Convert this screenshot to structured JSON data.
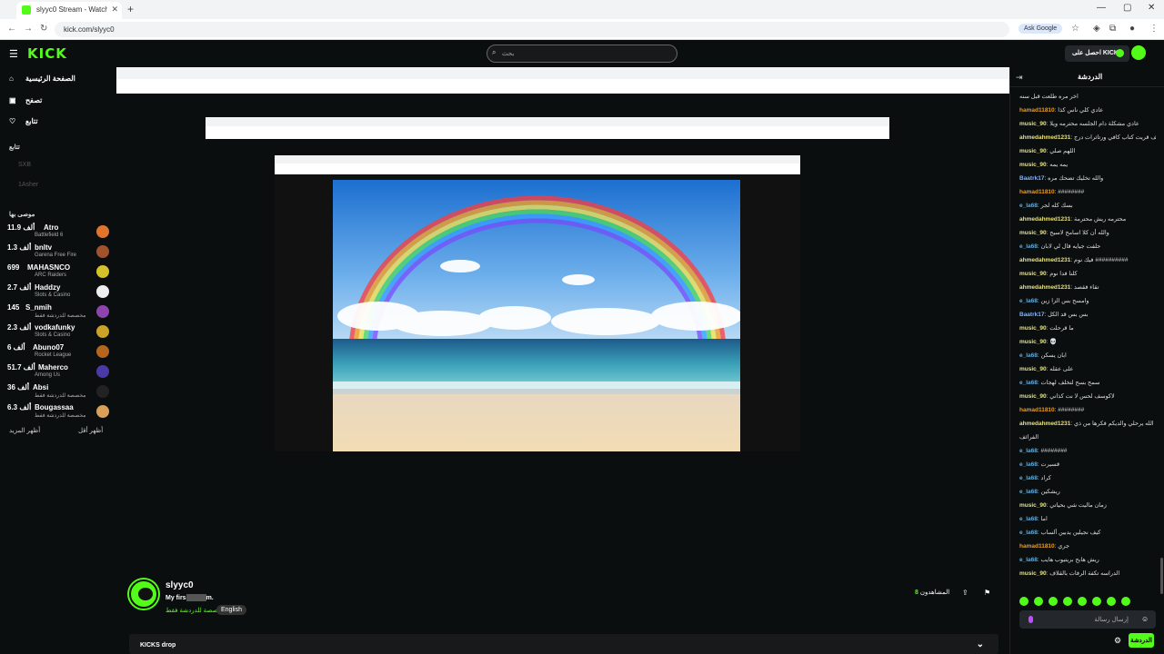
{
  "browser": {
    "tab_title": "slyyc0 Stream - Watch Live on Kick",
    "url": "kick.com/slyyc0",
    "ask_google": "Ask Google"
  },
  "header": {
    "logo": "KICK",
    "search_placeholder": "بحث",
    "get_kicks": "احصل على KICKs"
  },
  "sidebar": {
    "nav": [
      {
        "label": "الصفحة الرئيسية",
        "icon": "home-icon"
      },
      {
        "label": "تصفح",
        "icon": "browse-icon"
      },
      {
        "label": "تتابع",
        "icon": "heart-icon"
      }
    ],
    "following_title": "تتابع",
    "followed": [
      "SXB",
      "1Asher"
    ],
    "recommended_title": "موصى بها",
    "channels": [
      {
        "viewers": "11.9 ألف",
        "name": "Atro",
        "category": "Battlefield 6",
        "color": "#e0742c"
      },
      {
        "viewers": "1.3 ألف",
        "name": "bnltv",
        "category": "Garena Free Fire",
        "color": "#a0522d"
      },
      {
        "viewers": "699",
        "name": "MAHASNCO",
        "category": "ARC Raiders",
        "color": "#d4c22a"
      },
      {
        "viewers": "2.7 ألف",
        "name": "Haddzy",
        "category": "Slots & Casino",
        "color": "#eeeeee"
      },
      {
        "viewers": "145",
        "name": "S_nmih",
        "category": "مخصصة للدردشة فقط",
        "color": "#8e44ad"
      },
      {
        "viewers": "2.3 ألف",
        "name": "vodkafunky",
        "category": "Slots & Casino",
        "color": "#c9a227"
      },
      {
        "viewers": "6 ألف",
        "name": "Abuno07",
        "category": "Rocket League",
        "color": "#b5651d"
      },
      {
        "viewers": "51.7 ألف",
        "name": "Maherco",
        "category": "Among Us",
        "color": "#4a3aa8"
      },
      {
        "viewers": "36 ألف",
        "name": "Absi",
        "category": "مخصصة للدردشة فقط",
        "color": "#222222"
      },
      {
        "viewers": "6.3 ألف",
        "name": "Bougassaa",
        "category": "مخصصة للدردشة فقط",
        "color": "#d9a05b"
      }
    ],
    "show_more": "أظهر المزيد",
    "show_less": "أظهر أقل"
  },
  "stream": {
    "channel_name": "slyyc0",
    "title_prefix": "My firs",
    "title_suffix": "m.",
    "category": "مخصصة للدردشة فقط",
    "language": "English",
    "viewers_label": "المشاهدون",
    "viewers_count": "8",
    "kicks_drop": "KICKS drop"
  },
  "chat": {
    "title": "الدردشة",
    "input_placeholder": "إرسال رسالة",
    "send_label": "الدردشة",
    "messages": [
      {
        "user": "",
        "color": "#ddd",
        "text": "اخر مره طلعت قبل سنه"
      },
      {
        "user": "hamad11810",
        "color": "#f39c12",
        "text": ": عادي كلي ناس كذا"
      },
      {
        "user": "music_90",
        "color": "#e8e27a",
        "text": ": عادي مشكلة دام الجلسه محترمه ويلا"
      },
      {
        "user": "ahmedahmed1231",
        "color": "#e8e27a",
        "text": ": تبحث معرف اسوالف قريت كتاب كافي ورتاثرات درج"
      },
      {
        "user": "music_90",
        "color": "#e8e27a",
        "text": ": اللهم صلي"
      },
      {
        "user": "music_90",
        "color": "#e8e27a",
        "text": ": يمه يمه"
      },
      {
        "user": "Baatrk17",
        "color": "#7fb3ff",
        "text": ": والله تخليك تضحك مره"
      },
      {
        "user": "hamad11810",
        "color": "#f39c12",
        "text": ": ########"
      },
      {
        "user": "e_la68",
        "color": "#5dade2",
        "text": ": بسك كله لجر"
      },
      {
        "user": "ahmedahmed1231",
        "color": "#e8e27a",
        "text": ": محترمه ريش محترمة"
      },
      {
        "user": "music_90",
        "color": "#e8e27a",
        "text": ": والله أن كلا اسامح لاسيح"
      },
      {
        "user": "e_la68",
        "color": "#5dade2",
        "text": ": حلفت جيايه قال لي لابان"
      },
      {
        "user": "ahmedahmed1231",
        "color": "#e8e27a",
        "text": ": فيك نوم ##########"
      },
      {
        "user": "music_90",
        "color": "#e8e27a",
        "text": ": كلنا فدا نوم"
      },
      {
        "user": "ahmedahmed1231",
        "color": "#e8e27a",
        "text": ": تقاء فقصد"
      },
      {
        "user": "e_la68",
        "color": "#5dade2",
        "text": ": وامسح بس الزا زين"
      },
      {
        "user": "Baatrk17",
        "color": "#7fb3ff",
        "text": ": بس بس قد الكل"
      },
      {
        "user": "music_90",
        "color": "#e8e27a",
        "text": ": ما قرحلت"
      },
      {
        "user": "music_90",
        "color": "#e8e27a",
        "text": ": 💀"
      },
      {
        "user": "e_la68",
        "color": "#5dade2",
        "text": ": ابان يسكن"
      },
      {
        "user": "music_90",
        "color": "#e8e27a",
        "text": ": على عقله"
      },
      {
        "user": "e_la68",
        "color": "#5dade2",
        "text": ": سمح بسح لتخلف لهجات"
      },
      {
        "user": "music_90",
        "color": "#e8e27a",
        "text": ": لاكوسف لحس لا نت كذاني"
      },
      {
        "user": "hamad11810",
        "color": "#f39c12",
        "text": ": ########"
      },
      {
        "user": "ahmedahmed1231",
        "color": "#e8e27a",
        "text": ": الله يرحلي والديكم فكرها من ذي"
      },
      {
        "user": "",
        "color": "#ddd",
        "text": "الفرائف"
      },
      {
        "user": "e_la68",
        "color": "#5dade2",
        "text": ": ########"
      },
      {
        "user": "e_la68",
        "color": "#5dade2",
        "text": ": قسيرت"
      },
      {
        "user": "e_la68",
        "color": "#5dade2",
        "text": ": كراد"
      },
      {
        "user": "e_la68",
        "color": "#5dade2",
        "text": ": ريشكين"
      },
      {
        "user": "music_90",
        "color": "#e8e27a",
        "text": ": زمان ماليت شي بحياتي"
      },
      {
        "user": "e_la68",
        "color": "#5dade2",
        "text": ": اما"
      },
      {
        "user": "e_la68",
        "color": "#5dade2",
        "text": ": كيف نجيلين يدبين ألساب"
      },
      {
        "user": "hamad11810",
        "color": "#f39c12",
        "text": ": جري"
      },
      {
        "user": "e_la68",
        "color": "#5dade2",
        "text": ": ريش هابح بريتيوب هايب"
      },
      {
        "user": "music_90",
        "color": "#e8e27a",
        "text": ": الدراسه تكفة الرفات بالقلاف"
      }
    ]
  }
}
